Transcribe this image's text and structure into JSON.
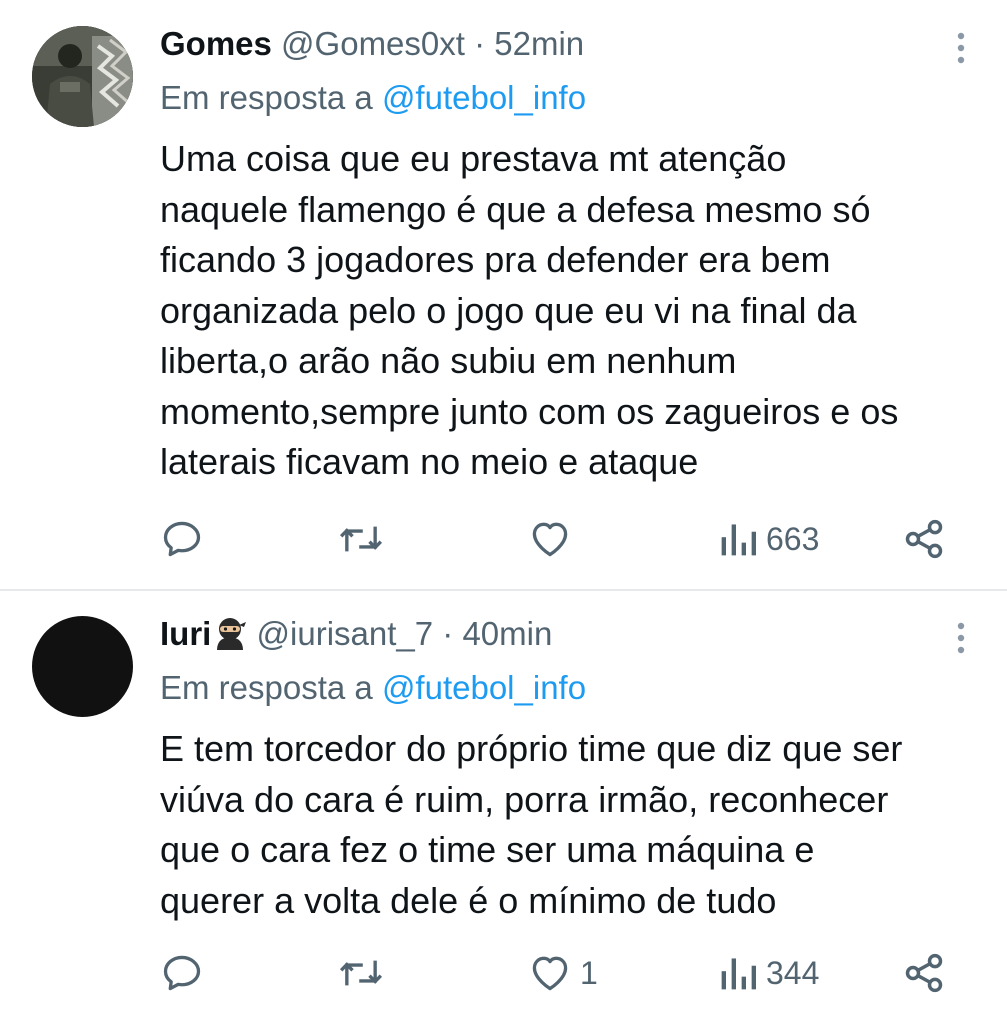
{
  "tweets": [
    {
      "name": "Gomes",
      "handle": "@Gomes0xt",
      "separator": "·",
      "time": "52min",
      "reply_prefix": "Em resposta a",
      "reply_to": "@futebol_info",
      "text_lines": [
        "Uma coisa que eu prestava mt atenção",
        "naquele flamengo é que a defesa mesmo só",
        "ficando 3 jogadores pra defender era bem",
        "organizada pelo o jogo que eu vi na final da",
        "liberta,o arão não subiu em nenhum",
        "momento,sempre junto com os zagueiros e os",
        "laterais ficavam no meio e ataque"
      ],
      "likes": "",
      "views": "663",
      "icons": {
        "reply": "reply-icon",
        "retweet": "retweet-icon",
        "like": "heart-icon",
        "views": "views-chart-icon",
        "share": "share-icon",
        "more": "more-vertical-icon"
      }
    },
    {
      "name": "Iuri",
      "name_emoji": "ninja-emoji",
      "handle": "@iurisant_7",
      "separator": "·",
      "time": "40min",
      "reply_prefix": "Em resposta a",
      "reply_to": "@futebol_info",
      "text_lines": [
        "E tem torcedor do próprio time que diz que ser",
        "viúva do cara é ruim, porra irmão, reconhecer",
        "que o cara fez o time ser uma máquina e",
        "querer a volta dele é o mínimo de tudo"
      ],
      "likes": "1",
      "views": "344",
      "icons": {
        "reply": "reply-icon",
        "retweet": "retweet-icon",
        "like": "heart-icon",
        "views": "views-chart-icon",
        "share": "share-icon",
        "more": "more-vertical-icon"
      }
    }
  ],
  "colors": {
    "text": "#0f1419",
    "secondary": "#536471",
    "link": "#1d9bf0",
    "divider": "#e7e9ea"
  }
}
